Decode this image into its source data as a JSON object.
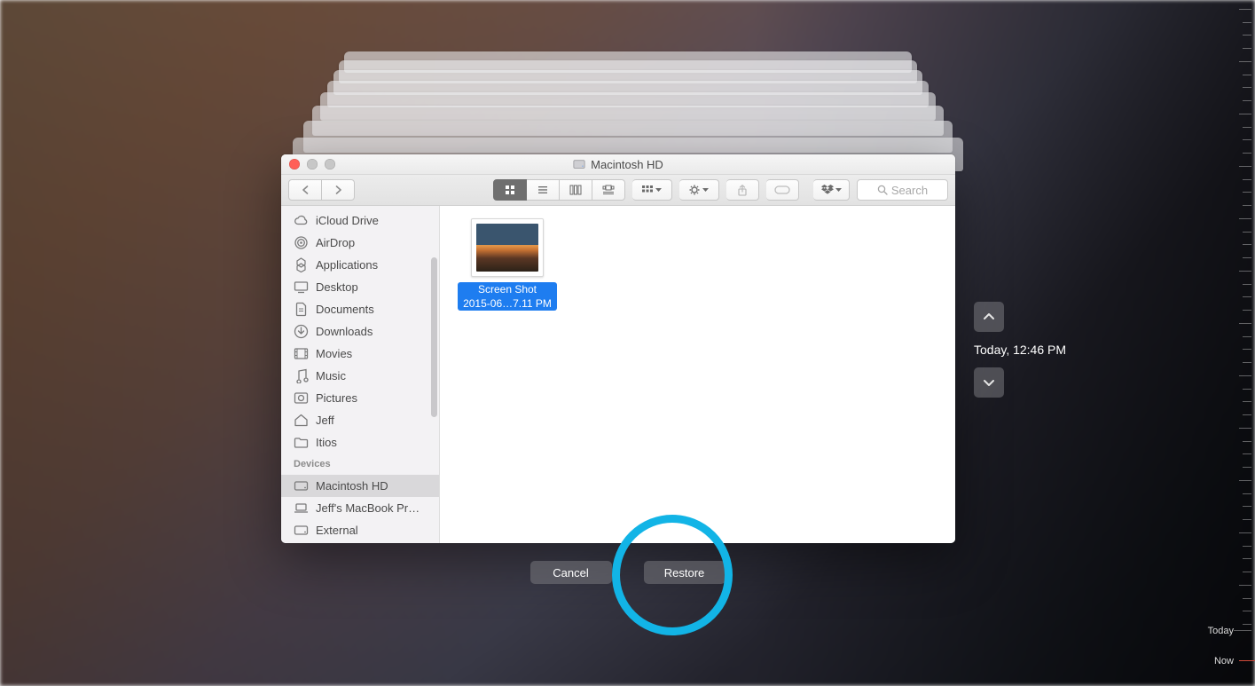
{
  "window": {
    "title": "Macintosh HD"
  },
  "toolbar": {
    "search_placeholder": "Search"
  },
  "sidebar": {
    "favorites": [
      {
        "icon": "cloud",
        "label": "iCloud Drive"
      },
      {
        "icon": "airdrop",
        "label": "AirDrop"
      },
      {
        "icon": "apps",
        "label": "Applications"
      },
      {
        "icon": "desktop",
        "label": "Desktop"
      },
      {
        "icon": "documents",
        "label": "Documents"
      },
      {
        "icon": "downloads",
        "label": "Downloads"
      },
      {
        "icon": "movies",
        "label": "Movies"
      },
      {
        "icon": "music",
        "label": "Music"
      },
      {
        "icon": "pictures",
        "label": "Pictures"
      },
      {
        "icon": "home",
        "label": "Jeff"
      },
      {
        "icon": "folder",
        "label": "Itios"
      }
    ],
    "devices_header": "Devices",
    "devices": [
      {
        "icon": "hd",
        "label": "Macintosh HD",
        "selected": true
      },
      {
        "icon": "laptop",
        "label": "Jeff's MacBook Pr…"
      },
      {
        "icon": "hd",
        "label": "External"
      }
    ]
  },
  "file": {
    "name_line1": "Screen Shot",
    "name_line2": "2015-06…7.11 PM"
  },
  "nav": {
    "timestamp": "Today, 12:46 PM"
  },
  "buttons": {
    "cancel": "Cancel",
    "restore": "Restore"
  },
  "timeline": {
    "today_label": "Today",
    "now_label": "Now"
  }
}
